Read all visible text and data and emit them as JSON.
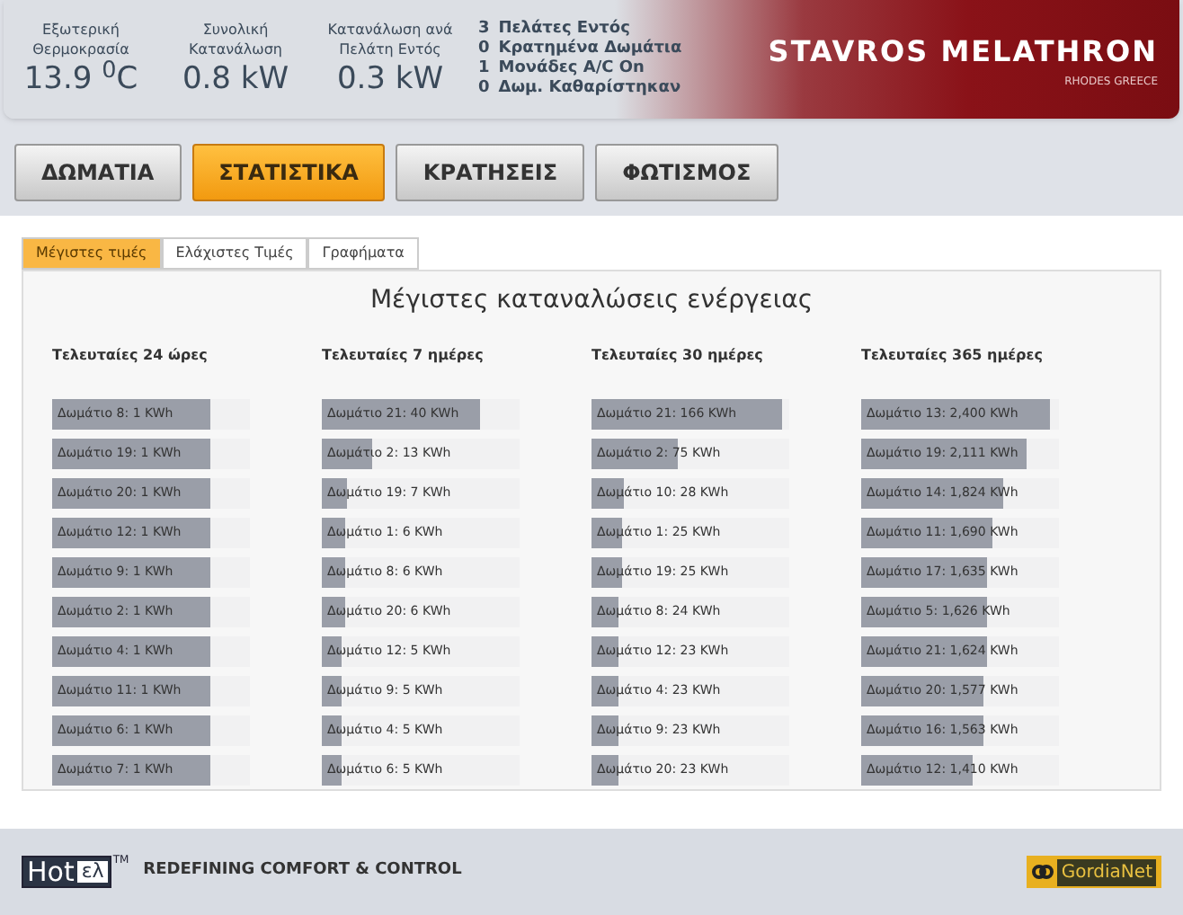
{
  "header": {
    "stats": [
      {
        "label": "Εξωτερική Θερμοκρασία",
        "value": "13.9 $^{0}$C"
      },
      {
        "label": "Συνολική Κατανάλωση",
        "value": "0.8 kW"
      },
      {
        "label": "Κατανάλωση ανά Πελάτη Εντός",
        "value": "0.3 kW"
      }
    ],
    "summary": [
      {
        "count": "3",
        "text": "Πελάτες Εντός"
      },
      {
        "count": "0",
        "text": "Κρατημένα Δωμάτια"
      },
      {
        "count": "1",
        "text": "Μονάδες A/C On"
      },
      {
        "count": "0",
        "text": "Δωμ. Καθαρίστηκαν"
      }
    ],
    "brand": "STAVROS MELATHRON",
    "brand_subtitle": "RHODES GREECE"
  },
  "nav": [
    {
      "label": "ΔΩΜΑΤΙΑ",
      "selected": false
    },
    {
      "label": "ΣΤΑΤΙΣΤΙΚΑ",
      "selected": true
    },
    {
      "label": "ΚΡΑΤΗΣΕΙΣ",
      "selected": false
    },
    {
      "label": "ΦΩΤΙΣΜΟΣ",
      "selected": false
    }
  ],
  "tabs": [
    {
      "label": "Μέγιστες τιμές",
      "selected": true
    },
    {
      "label": "Ελάχιστες Τιμές",
      "selected": false
    },
    {
      "label": "Γραφήματα",
      "selected": false
    }
  ],
  "title": "Μέγιστες καταναλώσεις ενέργειας",
  "columns": [
    {
      "heading": "Τελευταίες 24 ώρες",
      "rows": [
        {
          "text": "Δωμάτιο 8: 1 KWh",
          "level": 0.8
        },
        {
          "text": "Δωμάτιο 19: 1 KWh",
          "level": 0.8
        },
        {
          "text": "Δωμάτιο 20: 1 KWh",
          "level": 0.8
        },
        {
          "text": "Δωμάτιο 12: 1 KWh",
          "level": 0.8
        },
        {
          "text": "Δωμάτιο 9: 1 KWh",
          "level": 0.8
        },
        {
          "text": "Δωμάτιο 2: 1 KWh",
          "level": 0.8
        },
        {
          "text": "Δωμάτιο 4: 1 KWh",
          "level": 0.8
        },
        {
          "text": "Δωμάτιο 11: 1 KWh",
          "level": 0.8
        },
        {
          "text": "Δωμάτιο 6: 1 KWh",
          "level": 0.8
        },
        {
          "text": "Δωμάτιο 7: 1 KWh",
          "level": 0.8
        }
      ]
    },
    {
      "heading": "Τελευταίες 7 ημέρες",
      "rows": [
        {
          "text": "Δωμάτιο 21: 40 KWh",
          "level": 0.8
        },
        {
          "text": "Δωμάτιο 2: 13 KWh",
          "level": 0.25
        },
        {
          "text": "Δωμάτιο 19: 7 KWh",
          "level": 0.13
        },
        {
          "text": "Δωμάτιο 1: 6 KWh",
          "level": 0.12
        },
        {
          "text": "Δωμάτιο 8: 6 KWh",
          "level": 0.12
        },
        {
          "text": "Δωμάτιο 20: 6 KWh",
          "level": 0.12
        },
        {
          "text": "Δωμάτιο 12: 5 KWh",
          "level": 0.1
        },
        {
          "text": "Δωμάτιο 9: 5 KWh",
          "level": 0.1
        },
        {
          "text": "Δωμάτιο 4: 5 KWh",
          "level": 0.1
        },
        {
          "text": "Δωμάτιο 6: 5 KWh",
          "level": 0.1
        }
      ]
    },
    {
      "heading": "Τελευταίες 30 ημέρες",
      "rows": [
        {
          "text": "Δωμάτιο 21: 166 KWh",
          "level": 0.96
        },
        {
          "text": "Δωμάτιο 2: 75 KWh",
          "level": 0.44
        },
        {
          "text": "Δωμάτιο 10: 28 KWh",
          "level": 0.16
        },
        {
          "text": "Δωμάτιο 1: 25 KWh",
          "level": 0.15
        },
        {
          "text": "Δωμάτιο 19: 25 KWh",
          "level": 0.15
        },
        {
          "text": "Δωμάτιο 8: 24 KWh",
          "level": 0.14
        },
        {
          "text": "Δωμάτιο 12: 23 KWh",
          "level": 0.14
        },
        {
          "text": "Δωμάτιο 4: 23 KWh",
          "level": 0.14
        },
        {
          "text": "Δωμάτιο 9: 23 KWh",
          "level": 0.14
        },
        {
          "text": "Δωμάτιο 20: 23 KWh",
          "level": 0.14
        }
      ]
    },
    {
      "heading": "Τελευταίες 365 ημέρες",
      "rows": [
        {
          "text": "Δωμάτιο 13: 2,400 KWh",
          "level": 0.95
        },
        {
          "text": "Δωμάτιο 19: 2,111 KWh",
          "level": 0.84
        },
        {
          "text": "Δωμάτιο 14: 1,824 KWh",
          "level": 0.72
        },
        {
          "text": "Δωμάτιο 11: 1,690 KWh",
          "level": 0.66
        },
        {
          "text": "Δωμάτιο 17: 1,635 KWh",
          "level": 0.64
        },
        {
          "text": "Δωμάτιο 5: 1,626 KWh",
          "level": 0.64
        },
        {
          "text": "Δωμάτιο 21: 1,624 KWh",
          "level": 0.64
        },
        {
          "text": "Δωμάτιο 20: 1,577 KWh",
          "level": 0.62
        },
        {
          "text": "Δωμάτιο 16: 1,563 KWh",
          "level": 0.62
        },
        {
          "text": "Δωμάτιο 12: 1,410 KWh",
          "level": 0.56
        }
      ]
    }
  ],
  "footer": {
    "logo_main": "Hot",
    "logo_box": "ελ",
    "trademark": "TM",
    "tagline": "REDEFINING COMFORT & CONTROL",
    "partner": "GordiaNet"
  }
}
